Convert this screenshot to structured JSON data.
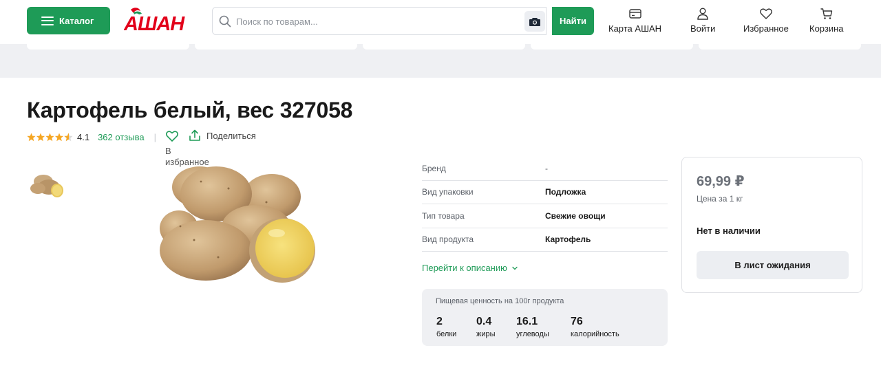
{
  "header": {
    "catalog_label": "Каталог",
    "logo_text": "АШАН",
    "search_placeholder": "Поиск по товарам...",
    "find_label": "Найти",
    "nav": [
      {
        "label": "Карта АШАН",
        "icon": "card-icon"
      },
      {
        "label": "Войти",
        "icon": "user-icon"
      },
      {
        "label": "Избранное",
        "icon": "heart-icon"
      },
      {
        "label": "Корзина",
        "icon": "cart-icon"
      }
    ]
  },
  "product": {
    "title": "Картофель белый, вес 327058",
    "rating": 4.1,
    "rating_text": "4.1",
    "reviews": "362 отзыва",
    "separator": "|",
    "favorite_label": "В избранное",
    "share_label": "Поделиться",
    "images": [
      "potato-thumbnail",
      "potato-main-image"
    ]
  },
  "specs": [
    {
      "key": "Бренд",
      "value": "-"
    },
    {
      "key": "Вид упаковки",
      "value": "Подложка"
    },
    {
      "key": "Тип товара",
      "value": "Свежие овощи"
    },
    {
      "key": "Вид продукта",
      "value": "Картофель"
    }
  ],
  "to_description": "Перейти к описанию",
  "nutrition": {
    "caption": "Пищевая ценность на 100г продукта",
    "items": [
      {
        "value": "2",
        "label": "белки"
      },
      {
        "value": "0.4",
        "label": "жиры"
      },
      {
        "value": "16.1",
        "label": "углеводы"
      },
      {
        "value": "76",
        "label": "калорийность"
      }
    ]
  },
  "price_card": {
    "price": "69,99 ₽",
    "per_unit": "Цена за 1 кг",
    "stock": "Нет в наличии",
    "wait_button": "В лист ожидания"
  },
  "colors": {
    "accent": "#1e9b57",
    "logo_red": "#e2001a",
    "star": "#f5a623",
    "band": "#eff0f3"
  }
}
